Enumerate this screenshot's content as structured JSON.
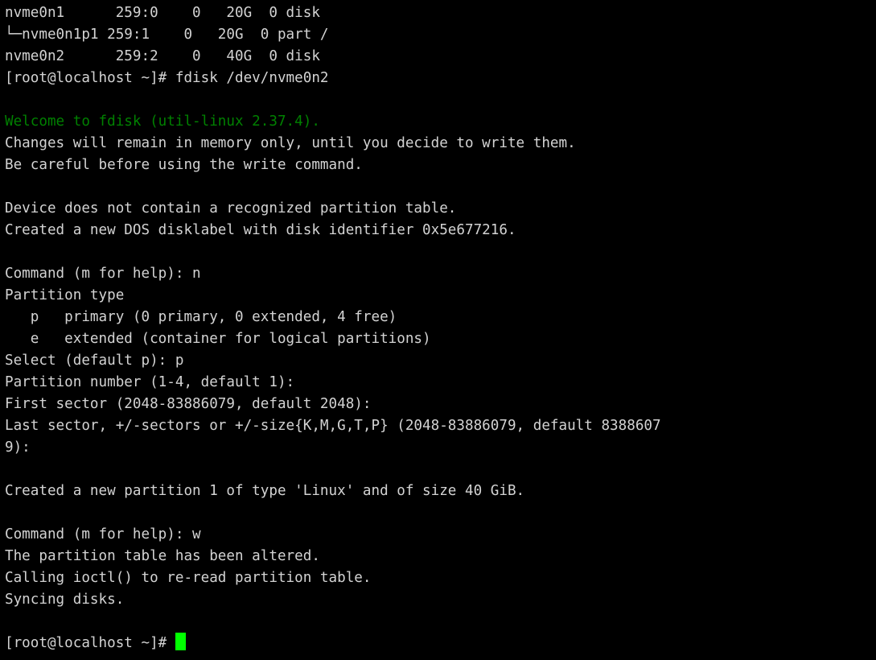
{
  "terminal": {
    "colors": {
      "background": "#000000",
      "foreground": "#d3d3d3",
      "welcome_green": "#008000",
      "cursor_green": "#00ff00"
    },
    "hostname": "localhost",
    "user": "root",
    "prompt": "[root@localhost ~]# ",
    "device": "/dev/nvme0n2",
    "fdisk_version": "util-linux 2.37.4",
    "disk_identifier": "0x5e677216",
    "lsblk": {
      "rows": [
        {
          "name": "nvme0n1",
          "majmin": "259:0",
          "rm": "0",
          "size": "20G",
          "ro": "0",
          "type": "disk",
          "mountpoint": ""
        },
        {
          "name": "└─nvme0n1p1",
          "majmin": "259:1",
          "rm": "0",
          "size": "20G",
          "ro": "0",
          "type": "part",
          "mountpoint": "/"
        },
        {
          "name": "nvme0n2",
          "majmin": "259:2",
          "rm": "0",
          "size": "40G",
          "ro": "0",
          "type": "disk",
          "mountpoint": ""
        }
      ]
    },
    "lines": [
      "nvme0n1      259:0    0   20G  0 disk ",
      "└─nvme0n1p1 259:1    0   20G  0 part /",
      "nvme0n2      259:2    0   40G  0 disk ",
      "[root@localhost ~]# fdisk /dev/nvme0n2",
      "",
      "Welcome to fdisk (util-linux 2.37.4).",
      "Changes will remain in memory only, until you decide to write them.",
      "Be careful before using the write command.",
      "",
      "Device does not contain a recognized partition table.",
      "Created a new DOS disklabel with disk identifier 0x5e677216.",
      "",
      "Command (m for help): n",
      "Partition type",
      "   p   primary (0 primary, 0 extended, 4 free)",
      "   e   extended (container for logical partitions)",
      "Select (default p): p",
      "Partition number (1-4, default 1): ",
      "First sector (2048-83886079, default 2048): ",
      "Last sector, +/-sectors or +/-size{K,M,G,T,P} (2048-83886079, default 8388607",
      "9): ",
      "",
      "Created a new partition 1 of type 'Linux' and of size 40 GiB.",
      "",
      "Command (m for help): w",
      "The partition table has been altered.",
      "Calling ioctl() to re-read partition table.",
      "Syncing disks.",
      ""
    ],
    "welcome_line": "Welcome to fdisk (util-linux 2.37.4).",
    "final_prompt": "[root@localhost ~]# "
  }
}
